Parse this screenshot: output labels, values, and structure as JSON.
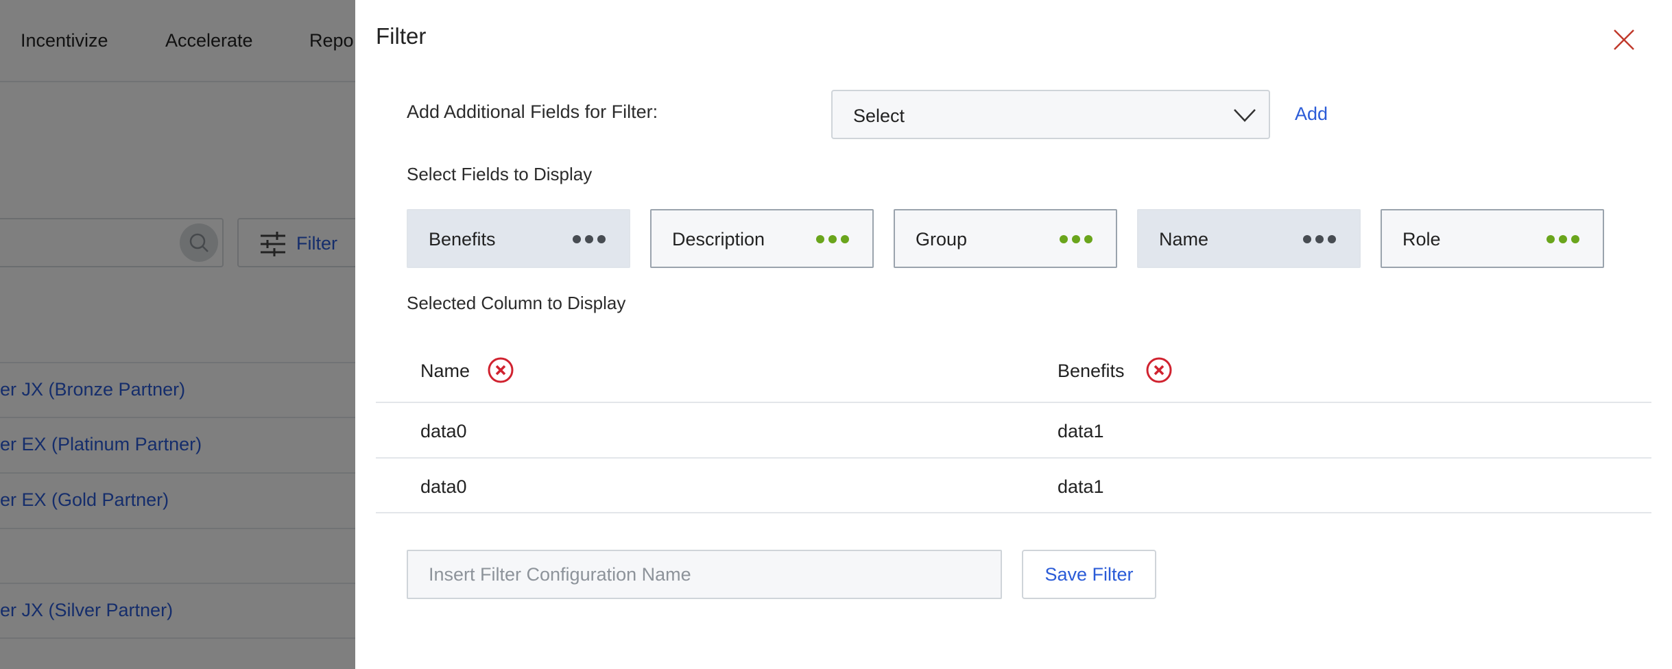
{
  "background": {
    "nav_items": [
      "Incentivize",
      "Accelerate",
      "Repo"
    ],
    "filter_button_label": "Filter",
    "rows": [
      "er JX (Bronze Partner)",
      "er EX (Platinum Partner)",
      "er EX (Gold Partner)",
      "",
      "er JX (Silver Partner)"
    ]
  },
  "panel": {
    "title": "Filter",
    "add_fields_label": "Add Additional Fields for Filter:",
    "select_value": "Select",
    "add_label": "Add",
    "fields_label": "Select Fields to Display",
    "fields": [
      {
        "label": "Benefits",
        "active": true
      },
      {
        "label": "Description",
        "active": false
      },
      {
        "label": "Group",
        "active": false
      },
      {
        "label": "Name",
        "active": true
      },
      {
        "label": "Role",
        "active": false
      }
    ],
    "columns_label": "Selected Column to Display",
    "table": {
      "headers": [
        "Name",
        "Benefits"
      ],
      "rows": [
        [
          "data0",
          "data1"
        ],
        [
          "data0",
          "data1"
        ]
      ]
    },
    "config_placeholder": "Insert Filter Configuration Name",
    "save_label": "Save Filter"
  },
  "colors": {
    "link_blue": "#2a5bd7",
    "dots_green": "#6aa51c",
    "dots_dark": "#474c52",
    "remove_red": "#d0222f"
  }
}
